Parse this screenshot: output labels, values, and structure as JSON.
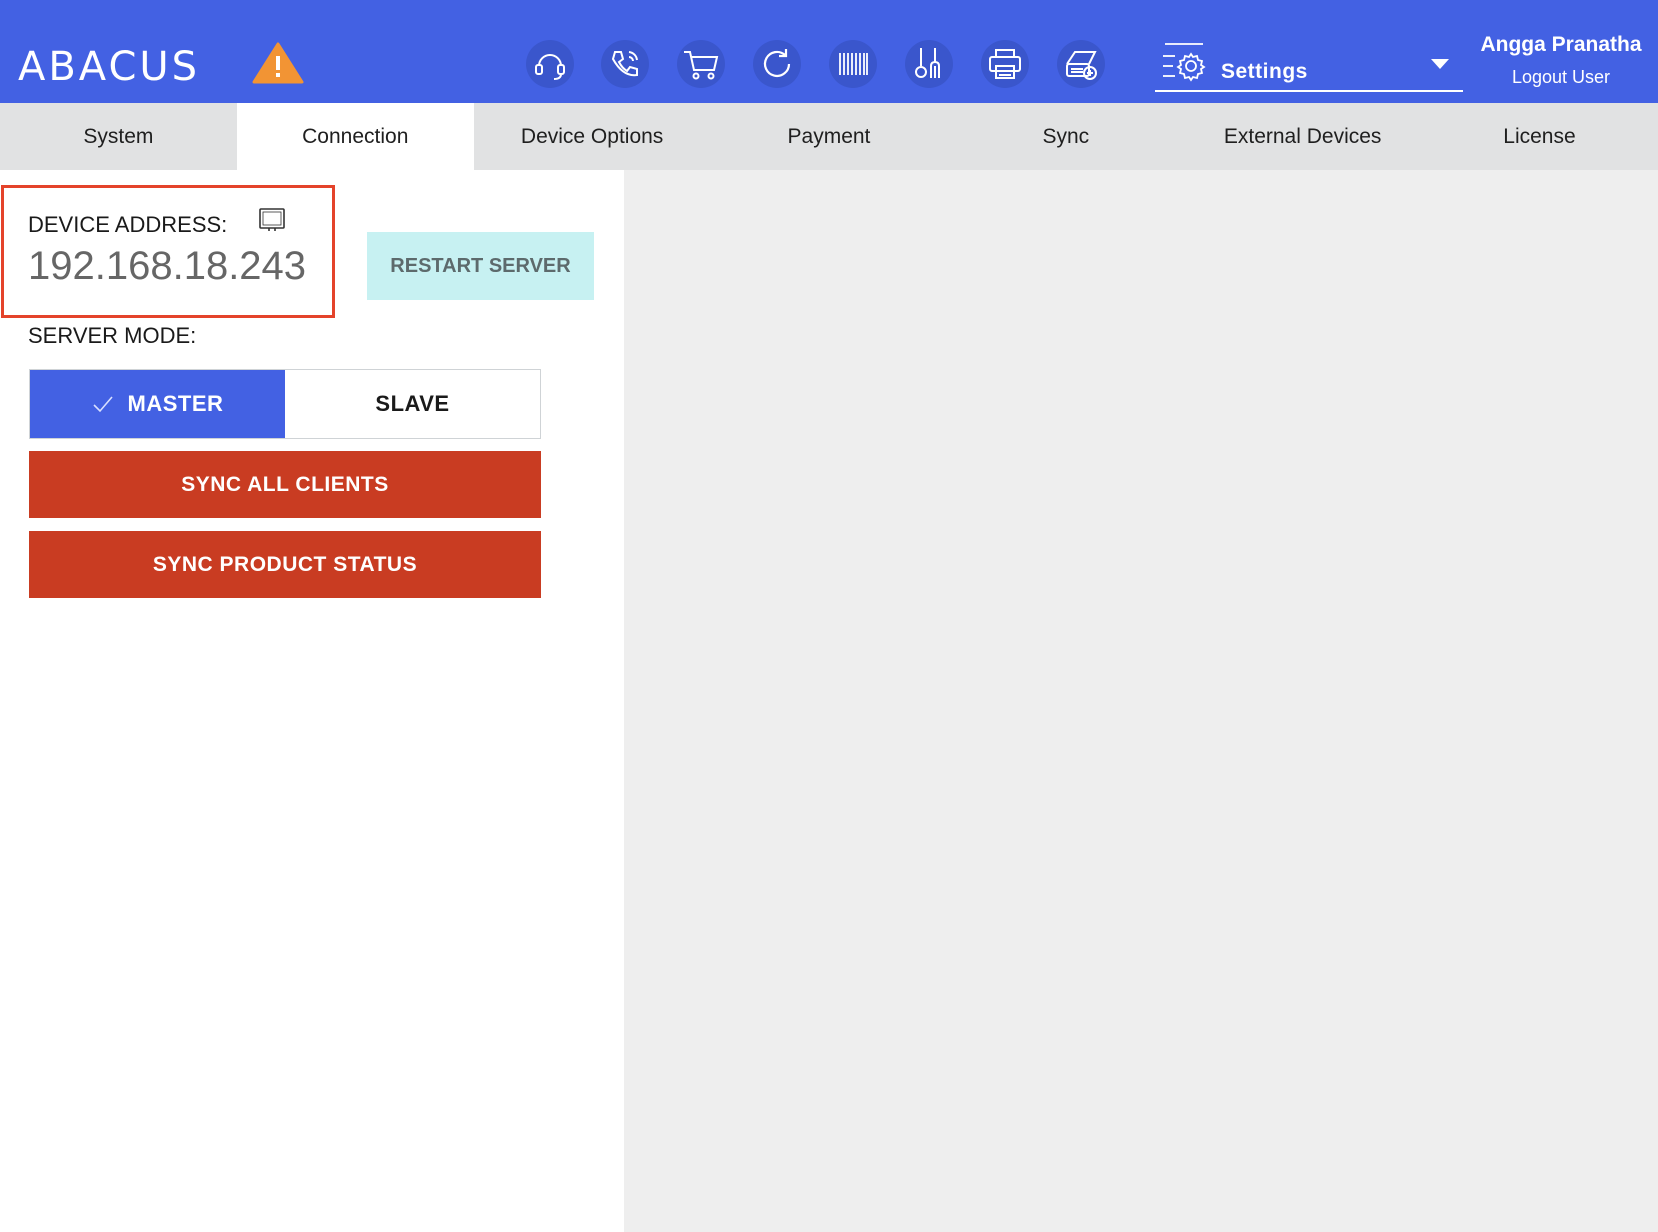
{
  "header": {
    "logo_text": "ABACUS",
    "warning_icon": "warning-triangle-icon",
    "nav_icons": [
      "headset-icon",
      "phone-icon",
      "cart-icon",
      "refresh-icon",
      "barcode-icon",
      "utensils-icon",
      "printer-icon",
      "add-device-icon"
    ],
    "settings_select": {
      "icon": "settings-gear-icon",
      "label": "Settings"
    },
    "user": {
      "name": "Angga Pranatha",
      "logout_label": "Logout User"
    }
  },
  "tabs": [
    {
      "label": "System",
      "active": false
    },
    {
      "label": "Connection",
      "active": true
    },
    {
      "label": "Device Options",
      "active": false
    },
    {
      "label": "Payment",
      "active": false
    },
    {
      "label": "Sync",
      "active": false
    },
    {
      "label": "External Devices",
      "active": false
    },
    {
      "label": "License",
      "active": false
    }
  ],
  "connection": {
    "device_address_label": "DEVICE ADDRESS:",
    "device_address_value": "192.168.18.243",
    "restart_label": "RESTART SERVER",
    "server_mode_label": "SERVER MODE:",
    "modes": {
      "master": "MASTER",
      "slave": "SLAVE",
      "selected": "MASTER"
    },
    "sync_all_label": "SYNC ALL CLIENTS",
    "sync_product_label": "SYNC PRODUCT STATUS"
  },
  "colors": {
    "brand": "#4361e3",
    "warning": "#f29434",
    "danger": "#c93c22",
    "restart_bg": "#c7f1f2",
    "highlight_border": "#e4432a"
  }
}
